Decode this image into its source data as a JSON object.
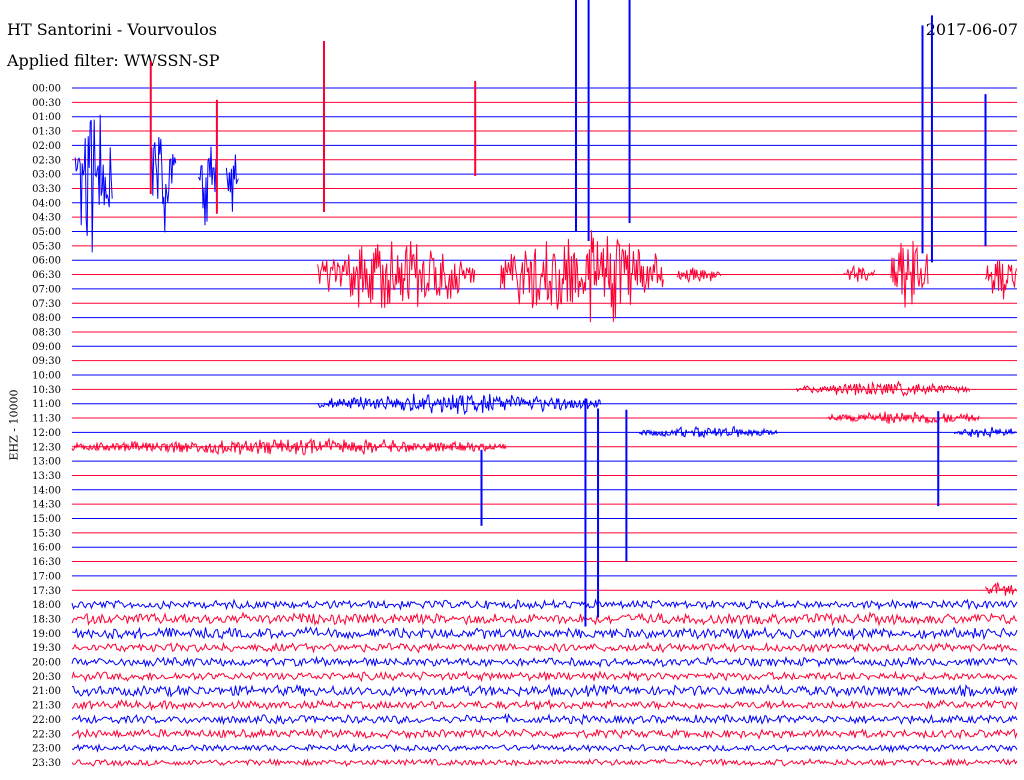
{
  "header": {
    "title": "HT Santorini - Vourvoulos",
    "subtitle": "Applied filter: WWSSN-SP",
    "date": "2017-06-07"
  },
  "colors": {
    "blue": "#0000ff",
    "red": "#ff0033"
  },
  "chart_data": {
    "type": "line",
    "ylabel": "EHZ - 10000",
    "grid": false,
    "x_unit": "minutes within each 30-minute row",
    "xlim": [
      0,
      30
    ],
    "rows": [
      "00:00",
      "00:30",
      "01:00",
      "01:30",
      "02:00",
      "02:30",
      "03:00",
      "03:30",
      "04:00",
      "04:30",
      "05:00",
      "05:30",
      "06:00",
      "06:30",
      "07:00",
      "07:30",
      "08:00",
      "08:30",
      "09:00",
      "09:30",
      "10:00",
      "10:30",
      "11:00",
      "11:30",
      "12:00",
      "12:30",
      "13:00",
      "13:30",
      "14:00",
      "14:30",
      "15:00",
      "15:30",
      "16:00",
      "16:30",
      "17:00",
      "17:30",
      "18:00",
      "18:30",
      "19:00",
      "19:30",
      "20:00",
      "20:30",
      "21:00",
      "21:30",
      "22:00",
      "22:30",
      "23:00",
      "23:30"
    ],
    "row_colors": [
      "blue",
      "red"
    ],
    "noise_amplitude_by_row": [
      0,
      0,
      0,
      0,
      0,
      0,
      0,
      0,
      0,
      0,
      0,
      0,
      0,
      0,
      0,
      0,
      0,
      0,
      0,
      0,
      0,
      0,
      0,
      0,
      0,
      0,
      0,
      0,
      0,
      0,
      0,
      0,
      0,
      0,
      0,
      0,
      4,
      5,
      5,
      4,
      4,
      4,
      5,
      4,
      4,
      4,
      3,
      3
    ],
    "bursts": [
      {
        "row": 6,
        "start": 0.1,
        "end": 1.3,
        "amplitude": 80
      },
      {
        "row": 6,
        "start": 2.5,
        "end": 3.3,
        "amplitude": 70
      },
      {
        "row": 6,
        "start": 4.0,
        "end": 4.6,
        "amplitude": 60
      },
      {
        "row": 6,
        "start": 4.9,
        "end": 5.3,
        "amplitude": 50
      },
      {
        "row": 13,
        "start": 7.8,
        "end": 12.8,
        "amplitude": 40
      },
      {
        "row": 13,
        "start": 13.6,
        "end": 18.8,
        "amplitude": 55
      },
      {
        "row": 13,
        "start": 19.2,
        "end": 20.6,
        "amplitude": 10
      },
      {
        "row": 13,
        "start": 24.5,
        "end": 25.5,
        "amplitude": 12
      },
      {
        "row": 13,
        "start": 26.0,
        "end": 27.2,
        "amplitude": 50
      },
      {
        "row": 13,
        "start": 29.0,
        "end": 30.0,
        "amplitude": 30
      },
      {
        "row": 21,
        "start": 23.0,
        "end": 28.5,
        "amplitude": 8
      },
      {
        "row": 22,
        "start": 7.8,
        "end": 16.8,
        "amplitude": 12
      },
      {
        "row": 23,
        "start": 24.0,
        "end": 28.8,
        "amplitude": 8
      },
      {
        "row": 24,
        "start": 18.0,
        "end": 22.4,
        "amplitude": 7
      },
      {
        "row": 24,
        "start": 28.0,
        "end": 30.0,
        "amplitude": 7
      },
      {
        "row": 25,
        "start": 0.0,
        "end": 13.8,
        "amplitude": 9
      },
      {
        "row": 35,
        "start": 29.0,
        "end": 30.0,
        "amplitude": 10
      }
    ],
    "spikes": [
      {
        "row": 3,
        "time": 2.5,
        "amplitude": 70
      },
      {
        "row": 5,
        "time": 4.6,
        "amplitude": 60
      },
      {
        "row": 3,
        "time": 8.0,
        "amplitude": 90
      },
      {
        "row": 3,
        "time": 12.8,
        "amplitude": 50
      },
      {
        "row": 0,
        "time": 16.0,
        "amplitude": 160
      },
      {
        "row": 0,
        "time": 16.4,
        "amplitude": 170
      },
      {
        "row": 0,
        "time": 17.7,
        "amplitude": 150
      },
      {
        "row": 4,
        "time": 27.0,
        "amplitude": 120
      },
      {
        "row": 4,
        "time": 27.3,
        "amplitude": 130
      },
      {
        "row": 6,
        "time": 29.0,
        "amplitude": 80
      },
      {
        "row": 30,
        "time": 16.3,
        "amplitude": 120
      },
      {
        "row": 30,
        "time": 16.7,
        "amplitude": 110
      },
      {
        "row": 28,
        "time": 17.6,
        "amplitude": 80
      },
      {
        "row": 28,
        "time": 13.0,
        "amplitude": 40
      },
      {
        "row": 26,
        "time": 27.5,
        "amplitude": 50
      }
    ]
  }
}
